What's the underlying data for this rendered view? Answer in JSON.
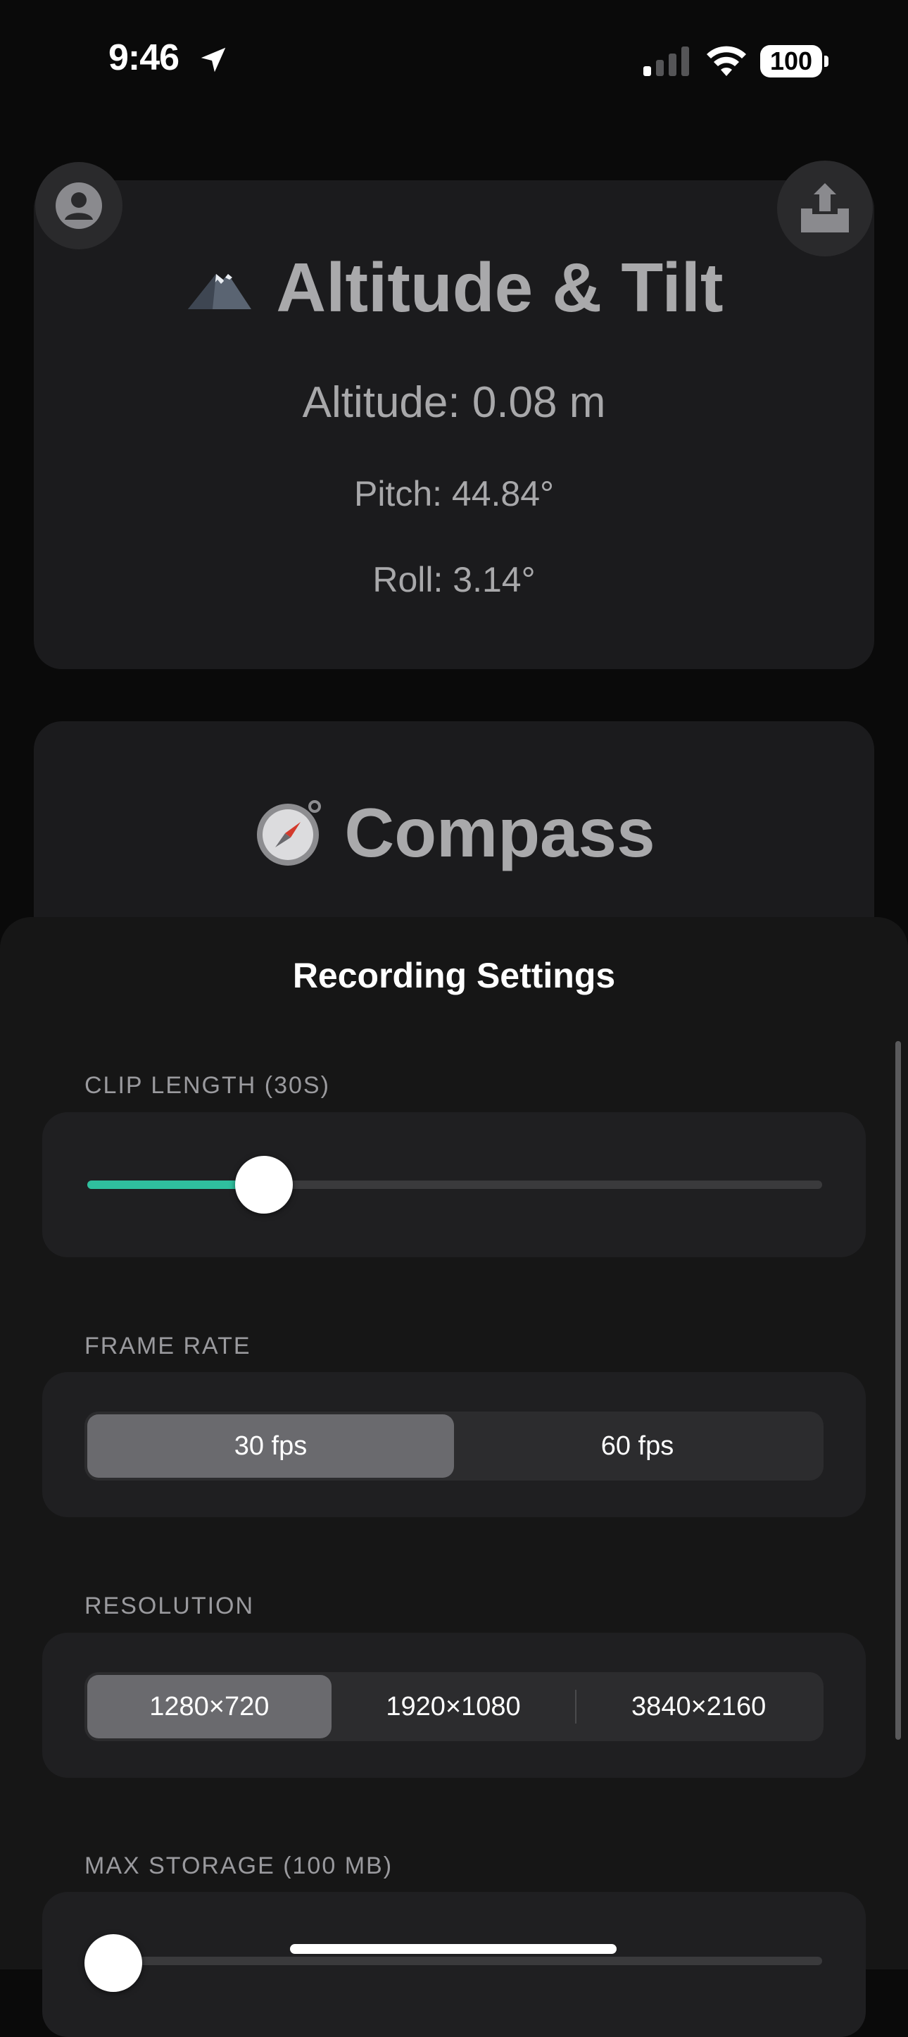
{
  "status_bar": {
    "time": "9:46",
    "battery": "100",
    "location_icon": "location-arrow-icon",
    "signal_icon": "cellular-signal-icon",
    "wifi_icon": "wifi-icon"
  },
  "altitude_card": {
    "icon": "mountain-icon",
    "title": "Altitude & Tilt",
    "altitude": "Altitude: 0.08 m",
    "pitch": "Pitch: 44.84°",
    "roll": "Roll: 3.14°"
  },
  "compass_card": {
    "icon": "compass-icon",
    "title": "Compass"
  },
  "header_buttons": {
    "profile_icon": "person-circle-icon",
    "share_icon": "share-upload-icon"
  },
  "sheet": {
    "title": "Recording Settings",
    "clip_length": {
      "label": "CLIP LENGTH (30S)",
      "slider_fraction": 0.24,
      "accent_color": "#2fbf9e"
    },
    "frame_rate": {
      "label": "FRAME RATE",
      "options": [
        "30 fps",
        "60 fps"
      ],
      "selected_index": 0
    },
    "resolution": {
      "label": "RESOLUTION",
      "options": [
        "1280×720",
        "1920×1080",
        "3840×2160"
      ],
      "selected_index": 0
    },
    "max_storage": {
      "label": "MAX STORAGE (100 MB)",
      "slider_fraction": 0.0
    }
  }
}
